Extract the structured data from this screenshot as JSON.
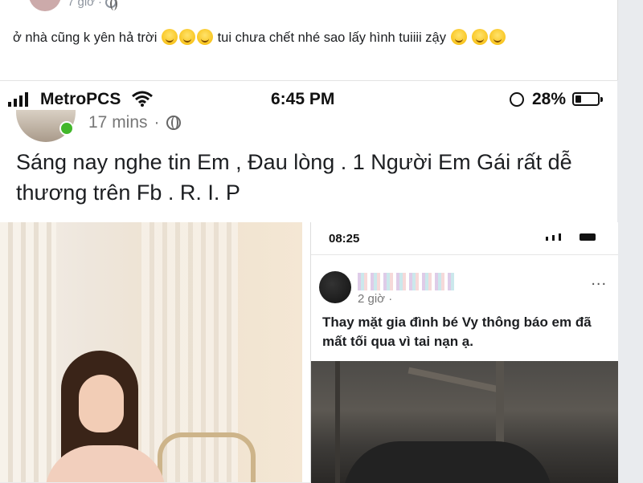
{
  "top_post": {
    "time": "7 giờ",
    "text": "ở nhà cũng k yên hả trời",
    "text2": "tui chưa chết nhé sao lấy hình tuiiii zậy"
  },
  "status_bar": {
    "carrier": "MetroPCS",
    "time": "6:45 PM",
    "battery": "28%"
  },
  "post": {
    "time": "17 mins",
    "separator": "·",
    "text": "Sáng nay nghe tin Em , Đau lòng . 1 Người Em Gái rất dễ thương trên Fb . R. I. P"
  },
  "inner_phone": {
    "time": "08:25",
    "post_time": "2 giờ ·",
    "post_text": "Thay mặt gia đình bé Vy thông báo em đã mất tối qua vì tai nạn ạ.",
    "more": "..."
  },
  "icons": {
    "signal": "signal-bars-icon",
    "wifi": "wifi-icon",
    "lock": "rotation-lock-icon",
    "battery": "battery-icon",
    "globe": "globe-icon",
    "emoji": "grinning-sweat-emoji"
  },
  "colors": {
    "online": "#42b72a",
    "background": "#e9ebee"
  }
}
